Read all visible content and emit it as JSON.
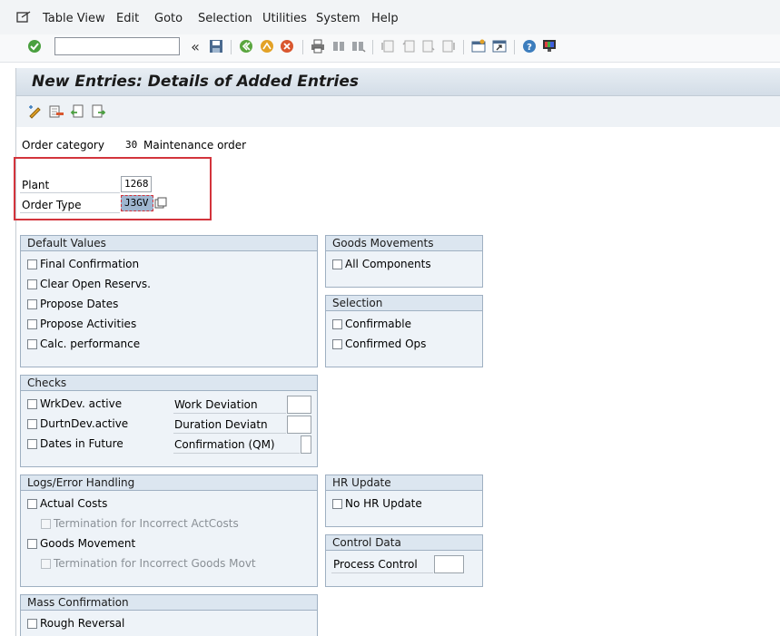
{
  "menu": {
    "items": [
      {
        "label": "Table View"
      },
      {
        "label": "Edit"
      },
      {
        "label": "Goto"
      },
      {
        "label": "Selection"
      },
      {
        "label": "Utilities"
      },
      {
        "label": "System"
      },
      {
        "label": "Help"
      }
    ]
  },
  "toolbar": {
    "command_field_value": "",
    "nav_back_glyph": "«",
    "icons": [
      "enter-check-icon",
      "save-icon",
      "back-icon",
      "exit-icon",
      "cancel-icon",
      "print-icon",
      "find-icon",
      "find-next-icon",
      "first-page-icon",
      "previous-page-icon",
      "next-page-icon",
      "last-page-icon",
      "create-session-icon",
      "shortcut-icon",
      "help-icon",
      "customize-layout-icon"
    ]
  },
  "page": {
    "title": "New Entries: Details of Added Entries"
  },
  "app_toolbar": {
    "icons": [
      "display-change-icon",
      "delete-icon",
      "previous-entry-icon",
      "next-entry-icon"
    ]
  },
  "header_fields": {
    "order_category": {
      "label": "Order category",
      "code": "30",
      "text": "Maintenance order"
    },
    "plant": {
      "label": "Plant",
      "value": "1268"
    },
    "order_type": {
      "label": "Order Type",
      "value": "J3GV"
    }
  },
  "groups": {
    "default_values": {
      "title": "Default Values",
      "items": [
        "Final Confirmation",
        "Clear Open Reservs.",
        "Propose Dates",
        "Propose Activities",
        "Calc. performance"
      ]
    },
    "goods_movements": {
      "title": "Goods Movements",
      "items": [
        "All Components"
      ]
    },
    "selection": {
      "title": "Selection",
      "items": [
        "Confirmable",
        "Confirmed Ops"
      ]
    },
    "checks": {
      "title": "Checks",
      "items": [
        "WrkDev. active",
        "DurtnDev.active",
        "Dates in Future"
      ],
      "fields": [
        "Work Deviation",
        "Duration Deviatn",
        "Confirmation (QM)"
      ]
    },
    "logs": {
      "title": "Logs/Error Handling",
      "actual_costs": "Actual Costs",
      "term_actcosts": "Termination for Incorrect ActCosts",
      "goods_movement": "Goods Movement",
      "term_goods": "Termination for Incorrect Goods Movt"
    },
    "hr_update": {
      "title": "HR Update",
      "items": [
        "No HR Update"
      ]
    },
    "control_data": {
      "title": "Control Data",
      "process_control": "Process Control"
    },
    "mass_confirmation": {
      "title": "Mass Confirmation",
      "items": [
        "Rough Reversal"
      ]
    }
  },
  "colors": {
    "highlight": "#d3343c",
    "group_header": "#dce6f0",
    "group_body": "#eef3f8"
  }
}
